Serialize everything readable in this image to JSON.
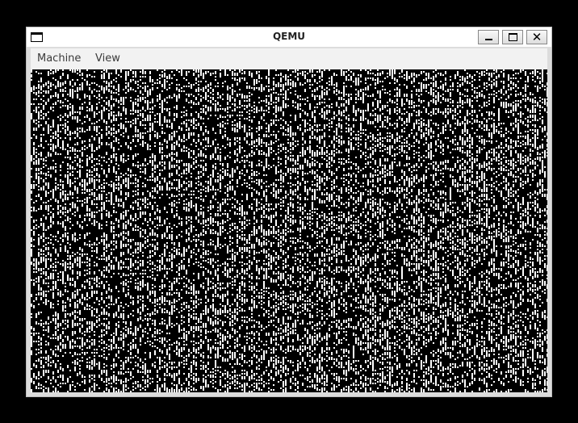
{
  "window": {
    "title": "QEMU",
    "controls": {
      "minimize_icon": "minimize-icon",
      "maximize_icon": "maximize-icon",
      "close_icon": "close-icon",
      "close_glyph": "✕"
    }
  },
  "menubar": {
    "items": [
      {
        "label": "Machine"
      },
      {
        "label": "View"
      }
    ]
  },
  "display": {
    "content": "static-noise",
    "background_color": "#000000",
    "noise_color": "#ffffff"
  }
}
